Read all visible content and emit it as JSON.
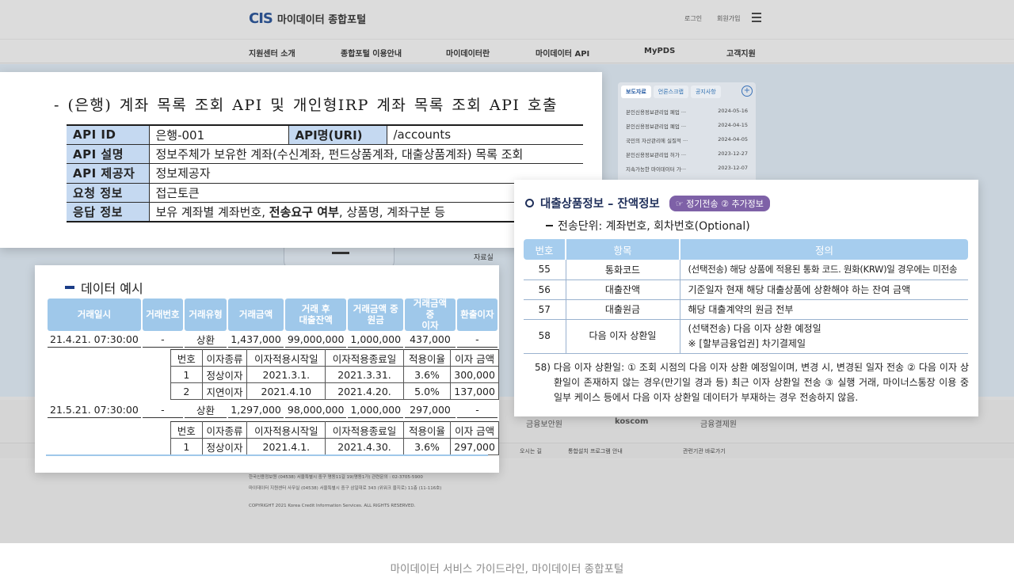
{
  "portal": {
    "logo_mark": "CIS",
    "logo_text": "마이데이터 종합포털",
    "login": "로그인",
    "signup": "회원가입",
    "nav": [
      "지원센터 소개",
      "종합포털 이용안내",
      "마이데이터란",
      "마이데이터 API",
      "MyPDS",
      "고객지원"
    ],
    "side_tabs": [
      "보도자료",
      "언론스크랩",
      "공지사항"
    ],
    "news": [
      {
        "title": "본인신용정보관리업 페업 ···",
        "date": "2024-05-16"
      },
      {
        "title": "본인신용정보관리업 폐업 ···",
        "date": "2024-04-15"
      },
      {
        "title": "국민의 자산관리에 실질적 ···",
        "date": "2024-04-05"
      },
      {
        "title": "본인신용정보관리업 허가 ···",
        "date": "2023-12-27"
      },
      {
        "title": "지속가능한 마이데이터 가···",
        "date": "2023-12-07"
      }
    ],
    "label_faq": "자료실",
    "partners": [
      "금융보안원",
      "koscom",
      "금융결제원"
    ],
    "footer_links": [
      "오시는 길",
      "통합설치 프로그램 안내",
      "관련기관 바로가기"
    ],
    "footer_lines": [
      "한국신용정보원 (04538) 서울특별시 중구 명동11길 19(명동1가) 관련문의 : 02-3705-5900",
      "마이데이터 지원센터 사무실 (04538) 서울특별시 중구 삼일대로 343 (위워크 을지로) 11층 (11-116호)",
      "COPYRIGHT 2021 Korea Credit Information Services. ALL RIGHTS RESERVED."
    ]
  },
  "api_spec": {
    "title": "- (은행) 계좌 목록 조회 API 및 개인형IRP 계좌 목록 조회 API 호출",
    "row1": {
      "k1": "API ID",
      "v1": "은행-001",
      "k2": "API명(URI)",
      "v2": "/accounts"
    },
    "rows": [
      {
        "key": "API 설명",
        "value": "정보주체가 보유한 계좌(수신계좌, 펀드상품계좌, 대출상품계좌) 목록 조회"
      },
      {
        "key": "API 제공자",
        "value": "정보제공자"
      },
      {
        "key": "요청 정보",
        "value": "접근토큰"
      }
    ],
    "response": {
      "key": "응답 정보",
      "pre": "보유 계좌별 계좌번호, ",
      "bold": "전송요구 여부",
      "post": ", 상품명, 계좌구분 등"
    }
  },
  "data_example": {
    "title": "데이터 예시",
    "headers": [
      "거래일시",
      "거래번호",
      "거래유형",
      "거래금액",
      "거래 후\n대출잔액",
      "거래금액 중\n원금",
      "거래금액 중\n이자",
      "환출이자"
    ],
    "transactions": [
      {
        "cells": [
          "21.4.21. 07:30:00",
          "-",
          "상환",
          "1,437,000",
          "99,000,000",
          "1,000,000",
          "437,000",
          "-"
        ],
        "sub_headers": [
          "번호",
          "이자종류",
          "이자적용시작일",
          "이자적용종료일",
          "적용이율",
          "이자 금액"
        ],
        "sub_rows": [
          [
            "1",
            "정상이자",
            "2021.3.1.",
            "2021.3.31.",
            "3.6%",
            "300,000"
          ],
          [
            "2",
            "지연이자",
            "2021.4.10",
            "2021.4.20.",
            "5.0%",
            "137,000"
          ]
        ]
      },
      {
        "cells": [
          "21.5.21. 07:30:00",
          "-",
          "상환",
          "1,297,000",
          "98,000,000",
          "1,000,000",
          "297,000",
          "-"
        ],
        "sub_headers": [
          "번호",
          "이자종류",
          "이자적용시작일",
          "이자적용종료일",
          "적용이율",
          "이자 금액"
        ],
        "sub_rows": [
          [
            "1",
            "정상이자",
            "2021.4.1.",
            "2021.4.30.",
            "3.6%",
            "297,000"
          ]
        ]
      }
    ]
  },
  "loan_info": {
    "title": "대출상품정보 – 잔액정보",
    "badge": "☞ 정기전송 ② 추가정보",
    "unit": "전송단위: 계좌번호, 회차번호(Optional)",
    "headers": [
      "번호",
      "항목",
      "정의"
    ],
    "rows": [
      {
        "no": "55",
        "item": "통화코드",
        "def": "(선택전송) 해당 상품에 적용된 통화 코드. 원화(KRW)일 경우에는 미전송"
      },
      {
        "no": "56",
        "item": "대출잔액",
        "def": "기준일자 현재 해당 대출상품에 상환해야 하는 잔여 금액"
      },
      {
        "no": "57",
        "item": "대출원금",
        "def": "해당 대출계약의 원금 전부"
      },
      {
        "no": "58",
        "item": "다음 이자 상환일",
        "def": "(선택전송) 다음 이자 상환 예정일",
        "def2": "※ [할부금융업권] 차기결제일"
      }
    ],
    "note": "58) 다음 이자 상환일: ① 조회 시점의 다음 이자 상환 예정일이며, 변경 시, 변경된 일자 전송 ② 다음 이자 상환일이 존재하지 않는 경우(만기일 경과 등) 최근 이자 상환일 전송 ③ 실행 거래, 마이너스통장 이용 중 일부 케이스 등에서 다음 이자 상환일 데이터가 부재하는 경우 전송하지 않음."
  },
  "caption": "마이데이터 서비스 가이드라인, 마이데이터 종합포털"
}
